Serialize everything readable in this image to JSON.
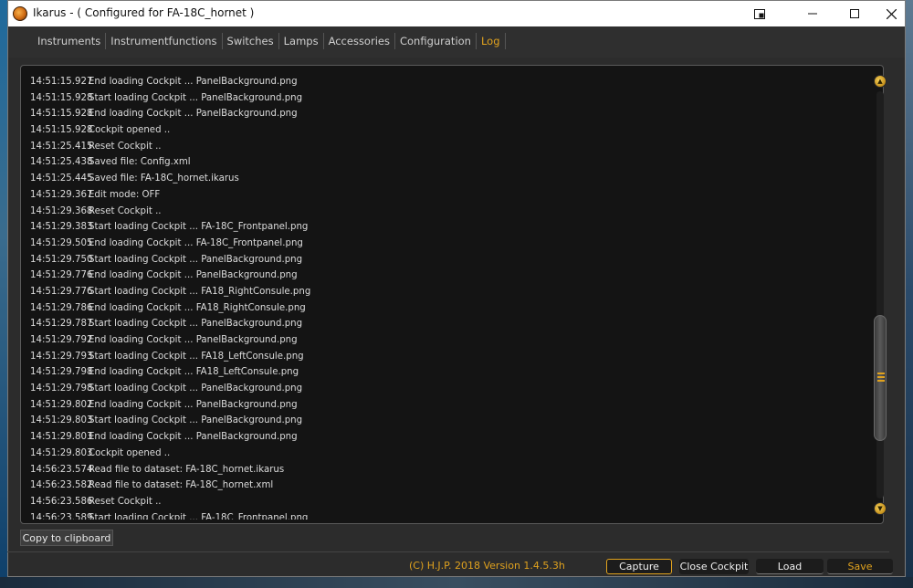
{
  "window": {
    "title": "Ikarus - ( Configured for FA-18C_hornet )"
  },
  "tabs": [
    {
      "label": "Instruments",
      "active": false
    },
    {
      "label": "Instrumentfunctions",
      "active": false
    },
    {
      "label": "Switches",
      "active": false
    },
    {
      "label": "Lamps",
      "active": false
    },
    {
      "label": "Accessories",
      "active": false
    },
    {
      "label": "Configuration",
      "active": false
    },
    {
      "label": "Log",
      "active": true
    }
  ],
  "log": [
    {
      "time": "14:51:15.927",
      "msg": "End loading Cockpit ... PanelBackground.png"
    },
    {
      "time": "14:51:15.928",
      "msg": "Start loading Cockpit ... PanelBackground.png"
    },
    {
      "time": "14:51:15.928",
      "msg": "End loading Cockpit ... PanelBackground.png"
    },
    {
      "time": "14:51:15.928",
      "msg": "Cockpit opened .."
    },
    {
      "time": "14:51:25.415",
      "msg": "Reset Cockpit .."
    },
    {
      "time": "14:51:25.438",
      "msg": "Saved file: Config.xml"
    },
    {
      "time": "14:51:25.445",
      "msg": "Saved file: FA-18C_hornet.ikarus"
    },
    {
      "time": "14:51:29.367",
      "msg": "Edit mode: OFF"
    },
    {
      "time": "14:51:29.368",
      "msg": "Reset Cockpit .."
    },
    {
      "time": "14:51:29.383",
      "msg": "Start loading Cockpit ... FA-18C_Frontpanel.png"
    },
    {
      "time": "14:51:29.505",
      "msg": "End loading Cockpit ... FA-18C_Frontpanel.png"
    },
    {
      "time": "14:51:29.750",
      "msg": "Start loading Cockpit ... PanelBackground.png"
    },
    {
      "time": "14:51:29.776",
      "msg": "End loading Cockpit ... PanelBackground.png"
    },
    {
      "time": "14:51:29.776",
      "msg": "Start loading Cockpit ... FA18_RightConsule.png"
    },
    {
      "time": "14:51:29.786",
      "msg": "End loading Cockpit ... FA18_RightConsule.png"
    },
    {
      "time": "14:51:29.787",
      "msg": "Start loading Cockpit ... PanelBackground.png"
    },
    {
      "time": "14:51:29.792",
      "msg": "End loading Cockpit ... PanelBackground.png"
    },
    {
      "time": "14:51:29.793",
      "msg": "Start loading Cockpit ... FA18_LeftConsule.png"
    },
    {
      "time": "14:51:29.798",
      "msg": "End loading Cockpit ... FA18_LeftConsule.png"
    },
    {
      "time": "14:51:29.798",
      "msg": "Start loading Cockpit ... PanelBackground.png"
    },
    {
      "time": "14:51:29.802",
      "msg": "End loading Cockpit ... PanelBackground.png"
    },
    {
      "time": "14:51:29.803",
      "msg": "Start loading Cockpit ... PanelBackground.png"
    },
    {
      "time": "14:51:29.803",
      "msg": "End loading Cockpit ... PanelBackground.png"
    },
    {
      "time": "14:51:29.803",
      "msg": "Cockpit opened .."
    },
    {
      "time": "14:56:23.574",
      "msg": "Read file to dataset: FA-18C_hornet.ikarus"
    },
    {
      "time": "14:56:23.582",
      "msg": "Read file to dataset: FA-18C_hornet.xml"
    },
    {
      "time": "14:56:23.586",
      "msg": "Reset Cockpit .."
    },
    {
      "time": "14:56:23.589",
      "msg": "Start loading Cockpit ... FA-18C_Frontpanel.png"
    }
  ],
  "buttons": {
    "copy": "Copy to clipboard",
    "capture": "Capture",
    "close_cockpit": "Close Cockpit",
    "load": "Load",
    "save": "Save"
  },
  "footer": {
    "version": "(C) H.J.P. 2018  Version 1.4.5.3h"
  },
  "colors": {
    "accent": "#e0a21e",
    "panel": "#141414",
    "window": "#2c2c2c"
  }
}
